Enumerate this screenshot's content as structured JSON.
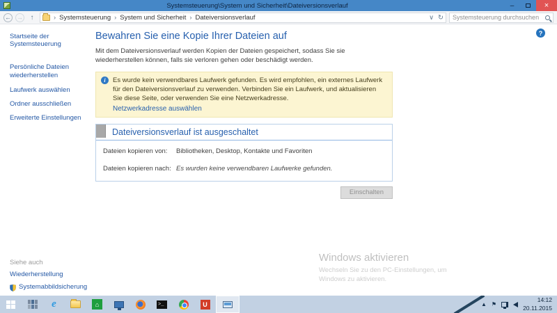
{
  "window": {
    "title": "Systemsteuerung\\System und Sicherheit\\Dateiversionsverlauf",
    "controls": {
      "minimize": "–",
      "close": "×"
    }
  },
  "toolbar": {
    "breadcrumb": [
      "Systemsteuerung",
      "System und Sicherheit",
      "Dateiversionsverlauf"
    ],
    "separator": "›",
    "back": "←",
    "forward": "→",
    "up": "↑",
    "dropdown": "∨",
    "refresh": "↻",
    "search_placeholder": "Systemsteuerung durchsuchen"
  },
  "sidebar": {
    "home": "Startseite der Systemsteuerung",
    "items": [
      "Persönliche Dateien wiederherstellen",
      "Laufwerk auswählen",
      "Ordner ausschließen",
      "Erweiterte Einstellungen"
    ],
    "see_also": "Siehe auch",
    "see_also_items": [
      "Wiederherstellung",
      "Systemabbildsicherung"
    ]
  },
  "main": {
    "title": "Bewahren Sie eine Kopie Ihrer Dateien auf",
    "description": "Mit dem Dateiversionsverlauf werden Kopien der Dateien gespeichert, sodass Sie sie wiederherstellen können, falls sie verloren gehen oder beschädigt werden.",
    "notice": {
      "text": "Es wurde kein verwendbares Laufwerk gefunden. Es wird empfohlen, ein externes Laufwerk für den Dateiversionsverlauf zu verwenden. Verbinden Sie ein Laufwerk, und aktualisieren Sie diese Seite, oder verwenden Sie eine Netzwerkadresse.",
      "link": "Netzwerkadresse auswählen"
    },
    "status": {
      "header": "Dateiversionsverlauf ist ausgeschaltet",
      "rows": [
        {
          "label": "Dateien kopieren von:",
          "value": "Bibliotheken, Desktop, Kontakte und Favoriten"
        },
        {
          "label": "Dateien kopieren nach:",
          "value": "Es wurden keine verwendbaren Laufwerke gefunden."
        }
      ]
    },
    "button": "Einschalten",
    "help": "?"
  },
  "watermark": {
    "title": "Windows aktivieren",
    "subtitle": "Wechseln Sie zu den PC-Einstellungen, um Windows zu aktivieren."
  },
  "taskbar": {
    "time": "14:12",
    "date": "20.11.2015",
    "tray_up": "▲",
    "tray_flag": "⚑"
  },
  "colors": {
    "titlebar": "#4587c7",
    "close_button": "#e15454",
    "link_blue": "#2458a5",
    "heading_blue": "#2760ae",
    "notice_bg": "#fcf5d2",
    "taskbar": "#c2d1e3"
  }
}
